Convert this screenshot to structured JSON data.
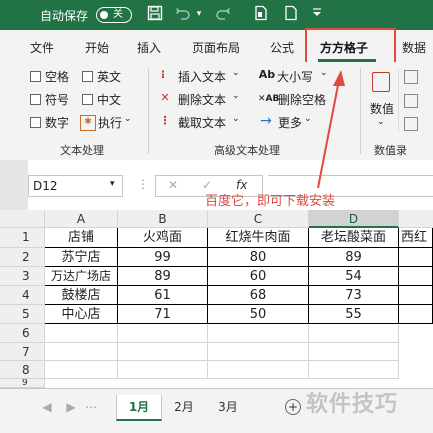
{
  "titlebar": {
    "autosave_label": "自动保存",
    "toggle_label": "关"
  },
  "tabs": [
    "文件",
    "开始",
    "插入",
    "页面布局",
    "公式",
    "方方格子",
    "数据"
  ],
  "ribbon": {
    "group1": {
      "items": [
        "空格",
        "英文",
        "符号",
        "中文",
        "数字",
        "执行"
      ],
      "label": "文本处理"
    },
    "group2": {
      "items": [
        "插入文本",
        "删除文本",
        "截取文本",
        "大小写",
        "删除空格",
        "更多"
      ],
      "label": "高级文本处理"
    },
    "group3": {
      "button": "数值",
      "label": "数值录"
    }
  },
  "formula_bar": {
    "name_box": "D12",
    "fx": "fx"
  },
  "annotation": "百度它，即可下载安装",
  "grid": {
    "columns": [
      "A",
      "B",
      "C",
      "D",
      "E"
    ],
    "rows": [
      "1",
      "2",
      "3",
      "4",
      "5",
      "6",
      "7",
      "8",
      "9"
    ],
    "header": [
      "店铺",
      "火鸡面",
      "红烧牛肉面",
      "老坛酸菜面",
      "西红"
    ],
    "data": [
      [
        "苏宁店",
        "99",
        "80",
        "89"
      ],
      [
        "万达广场店",
        "89",
        "60",
        "54"
      ],
      [
        "鼓楼店",
        "61",
        "68",
        "73"
      ],
      [
        "中心店",
        "71",
        "50",
        "55"
      ]
    ]
  },
  "sheets": [
    "1月",
    "2月",
    "3月"
  ],
  "watermark": "软件技巧",
  "colors": {
    "excel_green": "#217346",
    "highlight_red": "#e04a3f"
  }
}
